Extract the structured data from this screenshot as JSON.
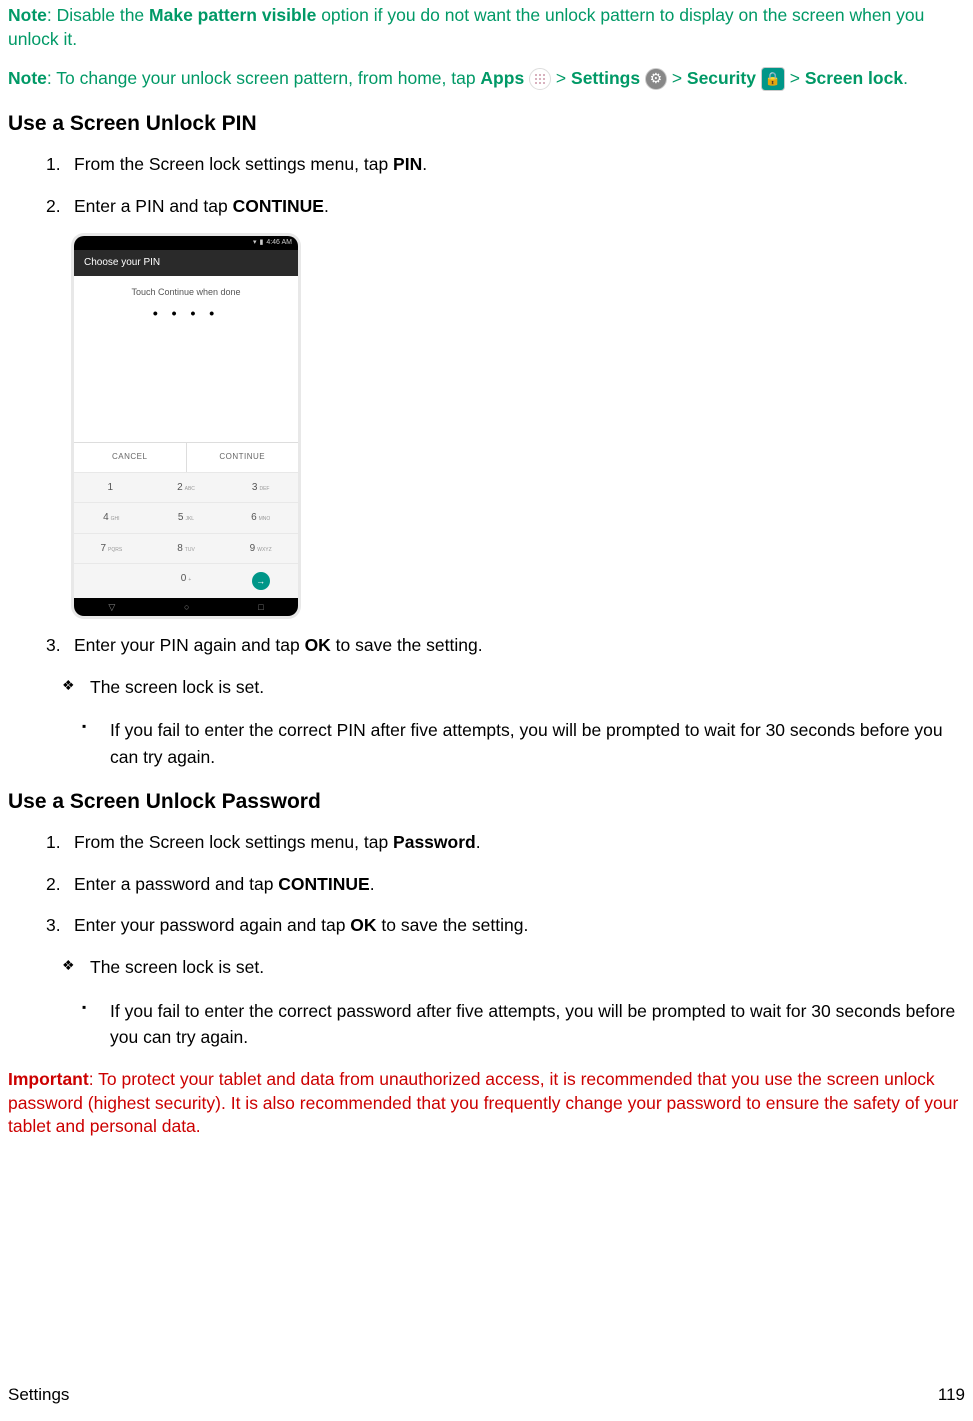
{
  "note1_prefix": "Note",
  "note1_part1": ": Disable the ",
  "note1_bold": "Make pattern visible",
  "note1_part2": " option if you do not want the unlock pattern to display on the screen when you unlock it.",
  "note2_prefix": "Note",
  "note2_part1": ": To change your unlock screen pattern, from home, tap ",
  "apps_label": "Apps",
  "gt": " > ",
  "settings_label": "Settings",
  "security_label": "Security",
  "screenlock_label": "Screen lock",
  "period": ".",
  "heading_pin": "Use a Screen Unlock PIN",
  "pin_step1_a": "From the Screen lock settings menu, tap ",
  "pin_step1_b": "PIN",
  "pin_step2_a": "Enter a PIN and tap ",
  "pin_step2_b": "CONTINUE",
  "pin_step3_a": "Enter your PIN again and tap ",
  "pin_step3_b": "OK",
  "pin_step3_c": " to save the setting.",
  "lockset": "The screen lock is set.",
  "pin_fail": "If you fail to enter the correct PIN after five attempts, you will be prompted to wait for 30 seconds before you can try again.",
  "heading_pw": "Use a Screen Unlock Password",
  "pw_step1_a": "From the Screen lock settings menu, tap ",
  "pw_step1_b": "Password",
  "pw_step2_a": "Enter a password and tap ",
  "pw_step2_b": "CONTINUE",
  "pw_step3_a": "Enter your password again and tap ",
  "pw_step3_b": "OK",
  "pw_step3_c": " to save the setting.",
  "pw_fail": "If you fail to enter the correct password after five attempts, you will be prompted to wait for 30 seconds before you can try again.",
  "important_prefix": "Important",
  "important_text": ": To protect your tablet and data from unauthorized access, it is recommended that you use the screen unlock password (highest security). It is also recommended that you frequently change your password to ensure the safety of your tablet and personal data.",
  "footer_left": "Settings",
  "footer_right": "119",
  "phone": {
    "status_time": "4:46 AM",
    "title": "Choose your PIN",
    "instruction": "Touch Continue when done",
    "dots": "• • • •",
    "cancel": "CANCEL",
    "continue": "CONTINUE",
    "keys": [
      [
        "1",
        "",
        "2",
        "ABC",
        "3",
        "DEF"
      ],
      [
        "4",
        "GHI",
        "5",
        "JKL",
        "6",
        "MNO"
      ],
      [
        "7",
        "PQRS",
        "8",
        "TUV",
        "9",
        "WXYZ"
      ]
    ],
    "zero": "0"
  }
}
